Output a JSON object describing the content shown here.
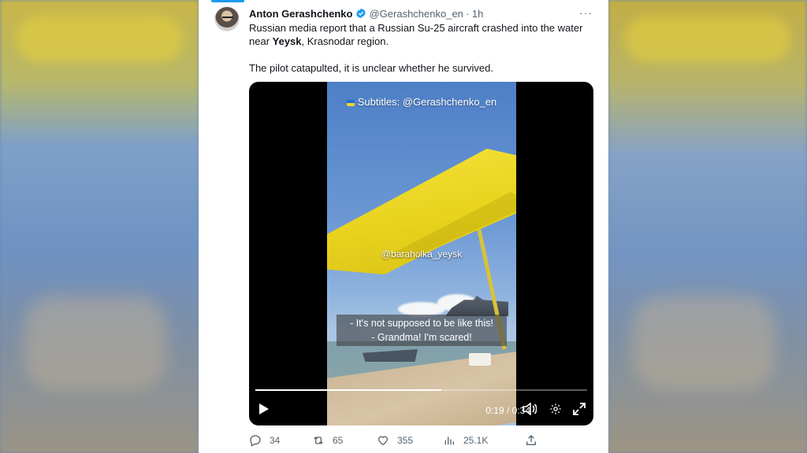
{
  "tweet": {
    "author": "Anton Gerashchenko",
    "handle": "@Gerashchenko_en",
    "time": "· 1h",
    "more": "···",
    "text_line1_pre": "Russian media report that a Russian Su-25 aircraft crashed into the water near ",
    "text_bold": "Yeysk",
    "text_line1_post": ", Krasnodar region.",
    "text_line2": "The pilot catapulted, it is unclear whether he survived."
  },
  "video": {
    "subtitle_top": "Subtitles: @Gerashchenko_en",
    "watermark": "@baraholka_yeysk",
    "caption_line1": "- It's not supposed to be like this!",
    "caption_line2": "- Grandma! I'm scared!",
    "time": "0:19 / 0:34",
    "progress_fraction": 0.56
  },
  "actions": {
    "replies": "34",
    "retweets": "65",
    "likes": "355",
    "views": "25.1K"
  },
  "colors": {
    "accent": "#1d9bf0",
    "text": "#0f1419",
    "muted": "#536471"
  }
}
